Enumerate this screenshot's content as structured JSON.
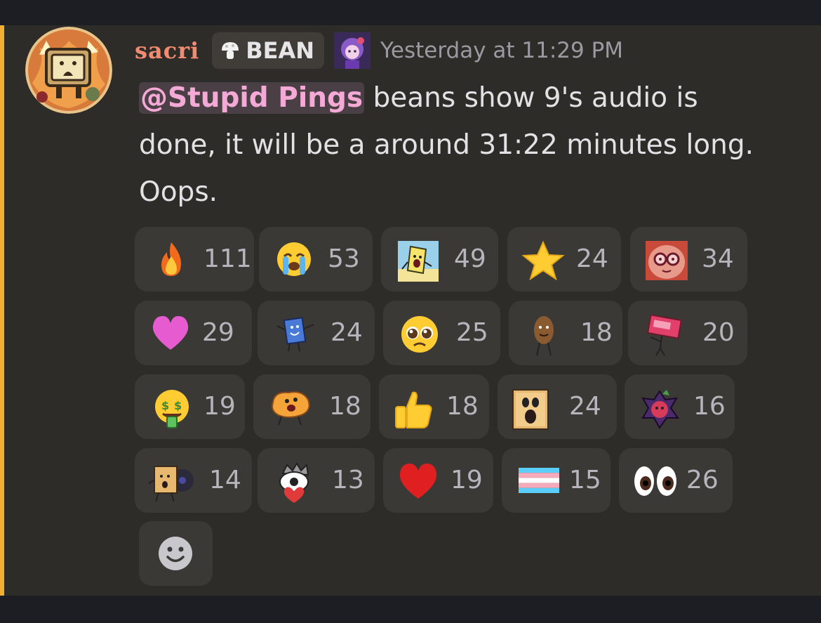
{
  "message": {
    "username": "sacri",
    "role_tag": "BEAN",
    "timestamp": "Yesterday at 11:29 PM",
    "mention": "@Stupid Pings",
    "text_line1": " beans show 9's audio is",
    "text_line2": "done, it will be a around 31:22 minutes long.",
    "text_line3": "Oops."
  },
  "reactions": [
    {
      "icon": "fire-icon",
      "count": "111"
    },
    {
      "icon": "crying-face-icon",
      "count": "53"
    },
    {
      "icon": "custom-yellow-character-emoji",
      "count": "49"
    },
    {
      "icon": "star-icon",
      "count": "24"
    },
    {
      "icon": "custom-pink-face-emoji",
      "count": "34"
    },
    {
      "icon": "pink-heart-icon",
      "count": "29"
    },
    {
      "icon": "custom-blue-book-emoji",
      "count": "24"
    },
    {
      "icon": "pleading-face-icon",
      "count": "25"
    },
    {
      "icon": "custom-bean-emoji",
      "count": "18"
    },
    {
      "icon": "custom-red-sign-emoji",
      "count": "20"
    },
    {
      "icon": "money-mouth-face-icon",
      "count": "19"
    },
    {
      "icon": "custom-orange-blob-emoji",
      "count": "18"
    },
    {
      "icon": "thumbs-up-icon",
      "count": "18"
    },
    {
      "icon": "custom-shocked-box-emoji",
      "count": "24"
    },
    {
      "icon": "custom-purple-flower-emoji",
      "count": "16"
    },
    {
      "icon": "custom-box-record-emoji",
      "count": "14"
    },
    {
      "icon": "custom-eyeball-heart-emoji",
      "count": "13"
    },
    {
      "icon": "red-heart-icon",
      "count": "19"
    },
    {
      "icon": "transgender-flag-icon",
      "count": "15"
    },
    {
      "icon": "eyes-icon",
      "count": "26"
    }
  ],
  "add_reaction_icon": "smiley-add-reaction-icon",
  "colors": {
    "background": "#2e2c28",
    "mention_text": "#f5a9d6",
    "username": "#f28b70",
    "highlight_bar": "#f0b132"
  }
}
